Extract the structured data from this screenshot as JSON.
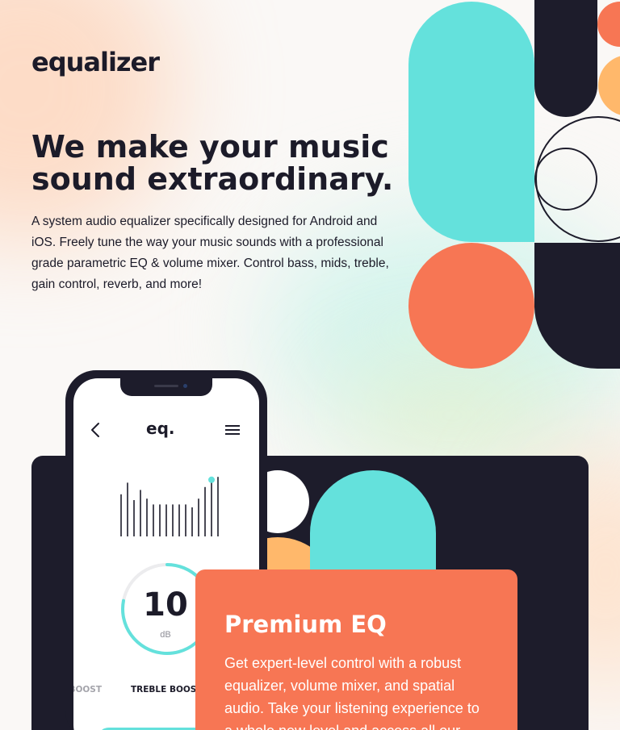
{
  "brand": {
    "logo": "equalizer"
  },
  "hero": {
    "headline": "We make your music sound extraordinary.",
    "description": "A system audio equalizer specifically designed for Android and iOS. Freely tune the way your music sounds with a professional grade parametric EQ & volume mixer. Control bass, mids, treble, gain control, reverb, and more!"
  },
  "phone": {
    "app_logo": "eq.",
    "back_icon": "chevron-left-icon",
    "menu_icon": "hamburger-menu-icon",
    "gain": {
      "value": "10",
      "unit": "dB",
      "level": 0.78
    },
    "presets": [
      "BASS BOOST",
      "TREBLE BOOST"
    ],
    "eq_levels": [
      0.58,
      0.74,
      0.5,
      0.64,
      0.52,
      0.44,
      0.44,
      0.44,
      0.44,
      0.44,
      0.44,
      0.4,
      0.52,
      0.68,
      0.78,
      0.82
    ]
  },
  "feature": {
    "title": "Premium EQ",
    "text": "Get expert-level control with a robust equalizer, volume mixer, and spatial audio. Take your listening experience to a whole new level and access all our"
  },
  "colors": {
    "navy": "#1d1c2b",
    "teal": "#64e1dc",
    "coral": "#f77654",
    "orange": "#ffb86b",
    "cream": "#faf8f6"
  }
}
